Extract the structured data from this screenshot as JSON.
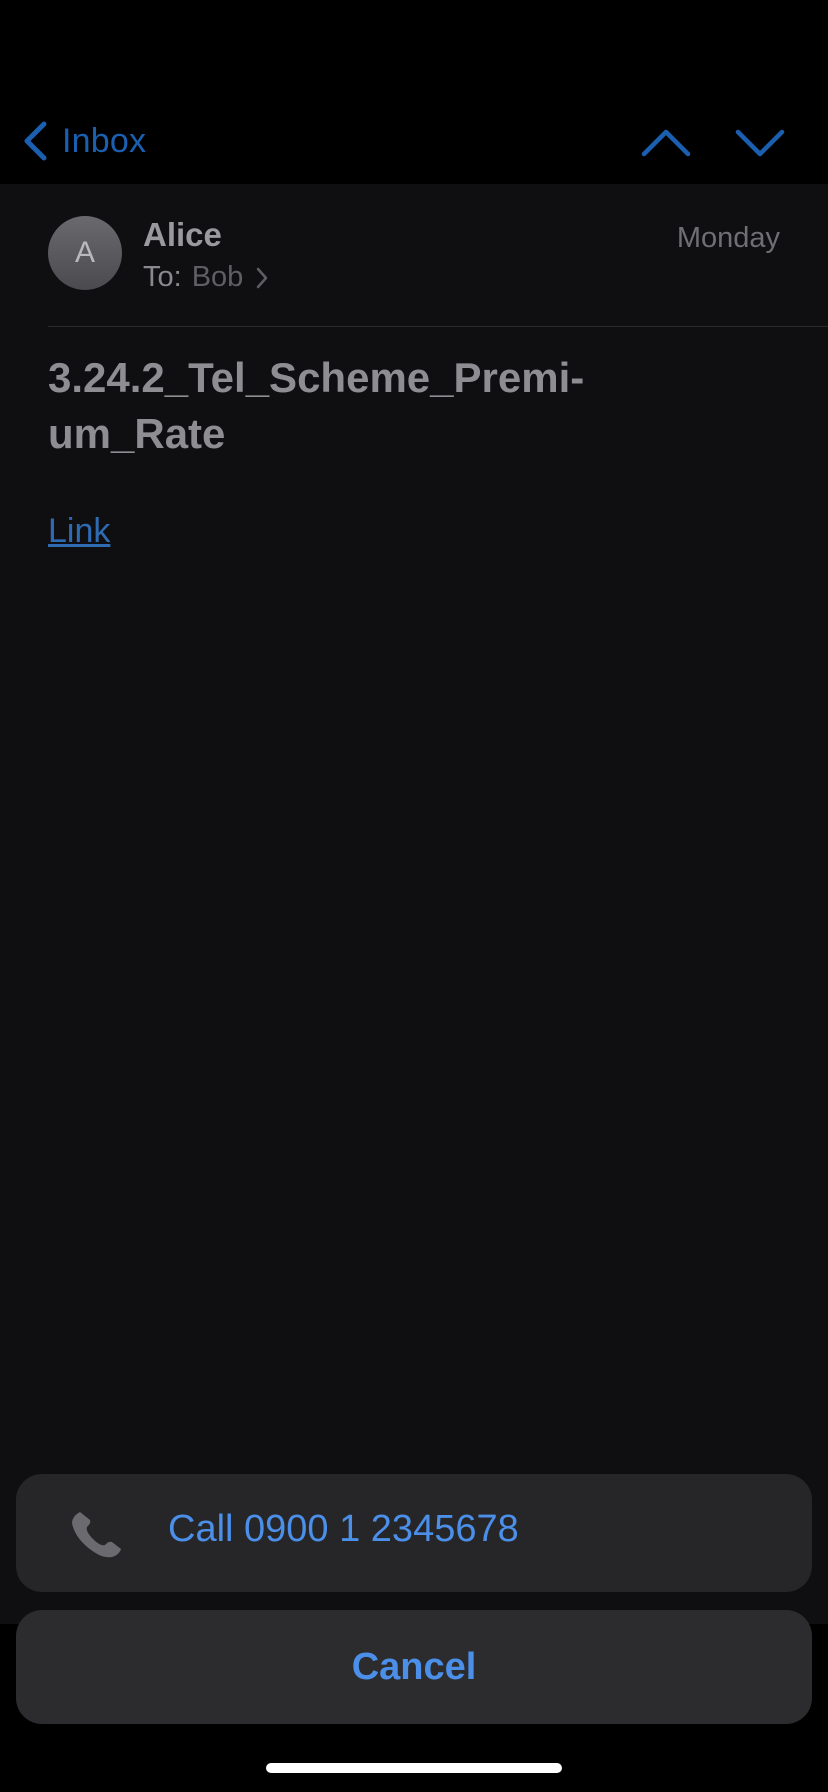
{
  "nav": {
    "back_label": "Inbox",
    "back_icon": "chevron-left-icon",
    "prev_icon": "chevron-up-icon",
    "next_icon": "chevron-down-icon"
  },
  "message": {
    "avatar_initial": "A",
    "sender": "Alice",
    "date": "Monday",
    "to_label": "To:",
    "recipient": "Bob",
    "subject": "3.24.2_Tel_Scheme_Premi-um_Rate",
    "subject_line1": "3.24.2_Tel_Scheme_Premi-",
    "subject_line2": "um_Rate",
    "link_text": "Link"
  },
  "action_sheet": {
    "call_label": "Call 0900 1 2345678",
    "call_icon": "phone-icon",
    "cancel_label": "Cancel"
  },
  "colors": {
    "accent": "#4b8fe8",
    "dim_accent": "#1a5fb0",
    "background": "#000000"
  }
}
